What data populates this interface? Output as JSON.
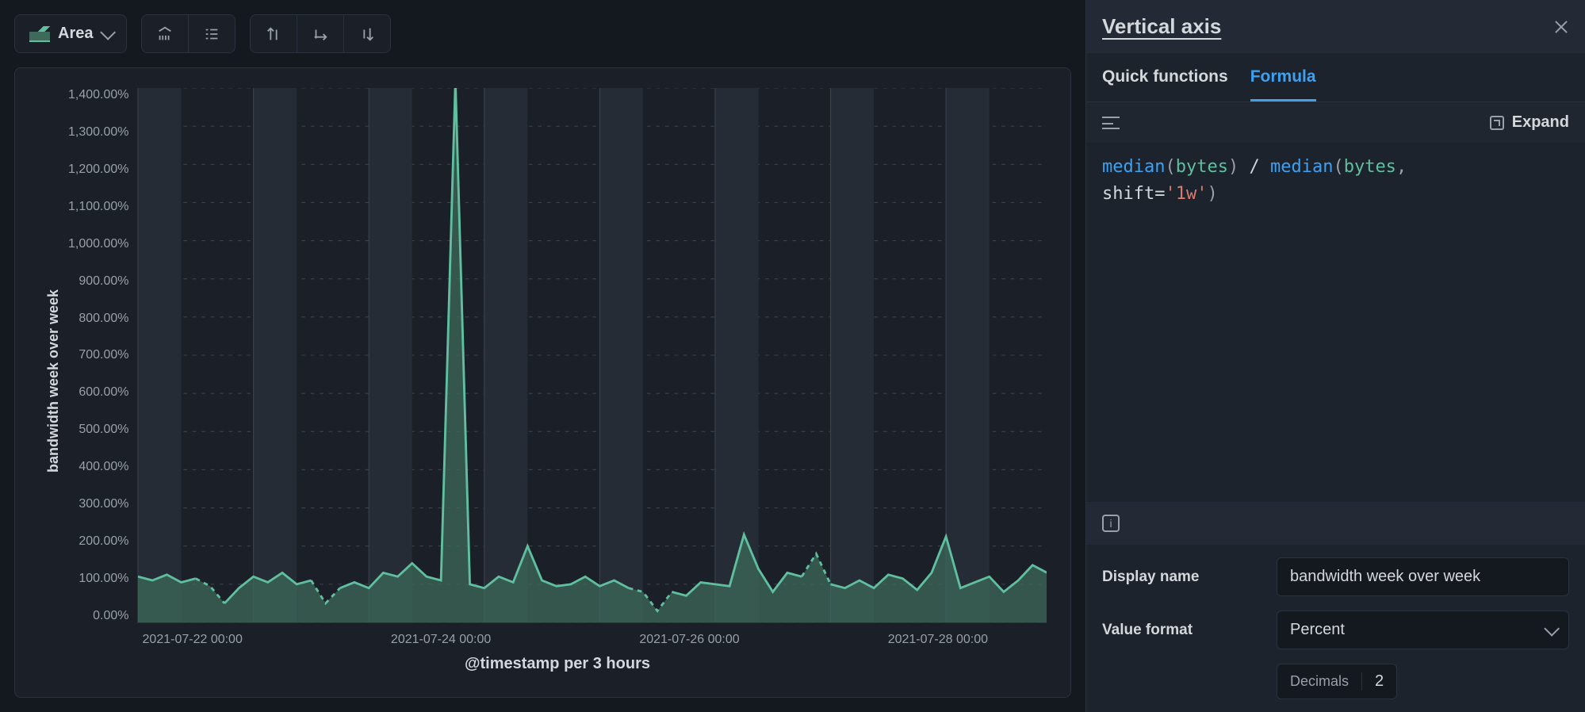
{
  "toolbar": {
    "chart_type_label": "Area",
    "icons": [
      "brush-icon",
      "legend-icon",
      "swap-vert-icon",
      "swap-horiz-icon",
      "sort-icon"
    ]
  },
  "chart_data": {
    "type": "area",
    "title": "",
    "xlabel": "@timestamp per 3 hours",
    "ylabel": "bandwidth week over week",
    "ylim": [
      0,
      1400
    ],
    "y_ticks": [
      "1,400.00%",
      "1,300.00%",
      "1,200.00%",
      "1,100.00%",
      "1,000.00%",
      "900.00%",
      "800.00%",
      "700.00%",
      "600.00%",
      "500.00%",
      "400.00%",
      "300.00%",
      "200.00%",
      "100.00%",
      "0.00%"
    ],
    "x_ticks": [
      "2021-07-22 00:00",
      "2021-07-24 00:00",
      "2021-07-26 00:00",
      "2021-07-28 00:00"
    ],
    "x": [
      "2021-07-21 00:00",
      "2021-07-21 03:00",
      "2021-07-21 06:00",
      "2021-07-21 09:00",
      "2021-07-21 12:00",
      "2021-07-21 15:00",
      "2021-07-21 18:00",
      "2021-07-21 21:00",
      "2021-07-22 00:00",
      "2021-07-22 03:00",
      "2021-07-22 06:00",
      "2021-07-22 09:00",
      "2021-07-22 12:00",
      "2021-07-22 15:00",
      "2021-07-22 18:00",
      "2021-07-22 21:00",
      "2021-07-23 00:00",
      "2021-07-23 03:00",
      "2021-07-23 06:00",
      "2021-07-23 09:00",
      "2021-07-23 12:00",
      "2021-07-23 15:00",
      "2021-07-23 18:00",
      "2021-07-23 21:00",
      "2021-07-24 00:00",
      "2021-07-24 03:00",
      "2021-07-24 06:00",
      "2021-07-24 09:00",
      "2021-07-24 12:00",
      "2021-07-24 15:00",
      "2021-07-24 18:00",
      "2021-07-24 21:00",
      "2021-07-25 00:00",
      "2021-07-25 03:00",
      "2021-07-25 06:00",
      "2021-07-25 09:00",
      "2021-07-25 12:00",
      "2021-07-25 15:00",
      "2021-07-25 18:00",
      "2021-07-25 21:00",
      "2021-07-26 00:00",
      "2021-07-26 03:00",
      "2021-07-26 06:00",
      "2021-07-26 09:00",
      "2021-07-26 12:00",
      "2021-07-26 15:00",
      "2021-07-26 18:00",
      "2021-07-26 21:00",
      "2021-07-27 00:00",
      "2021-07-27 03:00",
      "2021-07-27 06:00",
      "2021-07-27 09:00",
      "2021-07-27 12:00",
      "2021-07-27 15:00",
      "2021-07-27 18:00",
      "2021-07-27 21:00",
      "2021-07-28 00:00",
      "2021-07-28 03:00",
      "2021-07-28 06:00",
      "2021-07-28 09:00",
      "2021-07-28 12:00",
      "2021-07-28 15:00",
      "2021-07-28 18:00",
      "2021-07-28 21:00"
    ],
    "values": [
      120,
      110,
      125,
      105,
      115,
      95,
      50,
      90,
      120,
      105,
      130,
      100,
      110,
      50,
      90,
      105,
      90,
      130,
      120,
      155,
      120,
      110,
      1420,
      100,
      90,
      120,
      105,
      200,
      110,
      95,
      100,
      120,
      95,
      110,
      90,
      80,
      30,
      80,
      70,
      105,
      100,
      95,
      230,
      140,
      80,
      130,
      120,
      180,
      100,
      90,
      110,
      90,
      125,
      115,
      85,
      130,
      225,
      90,
      105,
      120,
      80,
      110,
      150,
      130
    ],
    "gap_indices": [
      [
        5,
        7
      ],
      [
        13,
        15
      ],
      [
        35,
        38
      ],
      [
        47,
        49
      ]
    ],
    "day_band_starts_idx": [
      0,
      8,
      16,
      24,
      32,
      40,
      48,
      56
    ],
    "day_band_width_idx": 3
  },
  "panel": {
    "title": "Vertical axis",
    "tabs": {
      "quick": "Quick functions",
      "formula": "Formula",
      "active": "formula"
    },
    "expand_label": "Expand",
    "formula_tokens": [
      {
        "t": "fn",
        "v": "median"
      },
      {
        "t": "punc",
        "v": "("
      },
      {
        "t": "id",
        "v": "bytes"
      },
      {
        "t": "punc",
        "v": ") "
      },
      {
        "t": "op",
        "v": "/"
      },
      {
        "t": "punc",
        "v": " "
      },
      {
        "t": "fn",
        "v": "median"
      },
      {
        "t": "punc",
        "v": "("
      },
      {
        "t": "id",
        "v": "bytes"
      },
      {
        "t": "punc",
        "v": ", \n"
      },
      {
        "t": "kw",
        "v": "shift"
      },
      {
        "t": "op",
        "v": "="
      },
      {
        "t": "str",
        "v": "'1w'"
      },
      {
        "t": "punc",
        "v": ")"
      }
    ],
    "form": {
      "display_name_label": "Display name",
      "display_name_value": "bandwidth week over week",
      "value_format_label": "Value format",
      "value_format_value": "Percent",
      "decimals_label": "Decimals",
      "decimals_value": "2"
    }
  }
}
